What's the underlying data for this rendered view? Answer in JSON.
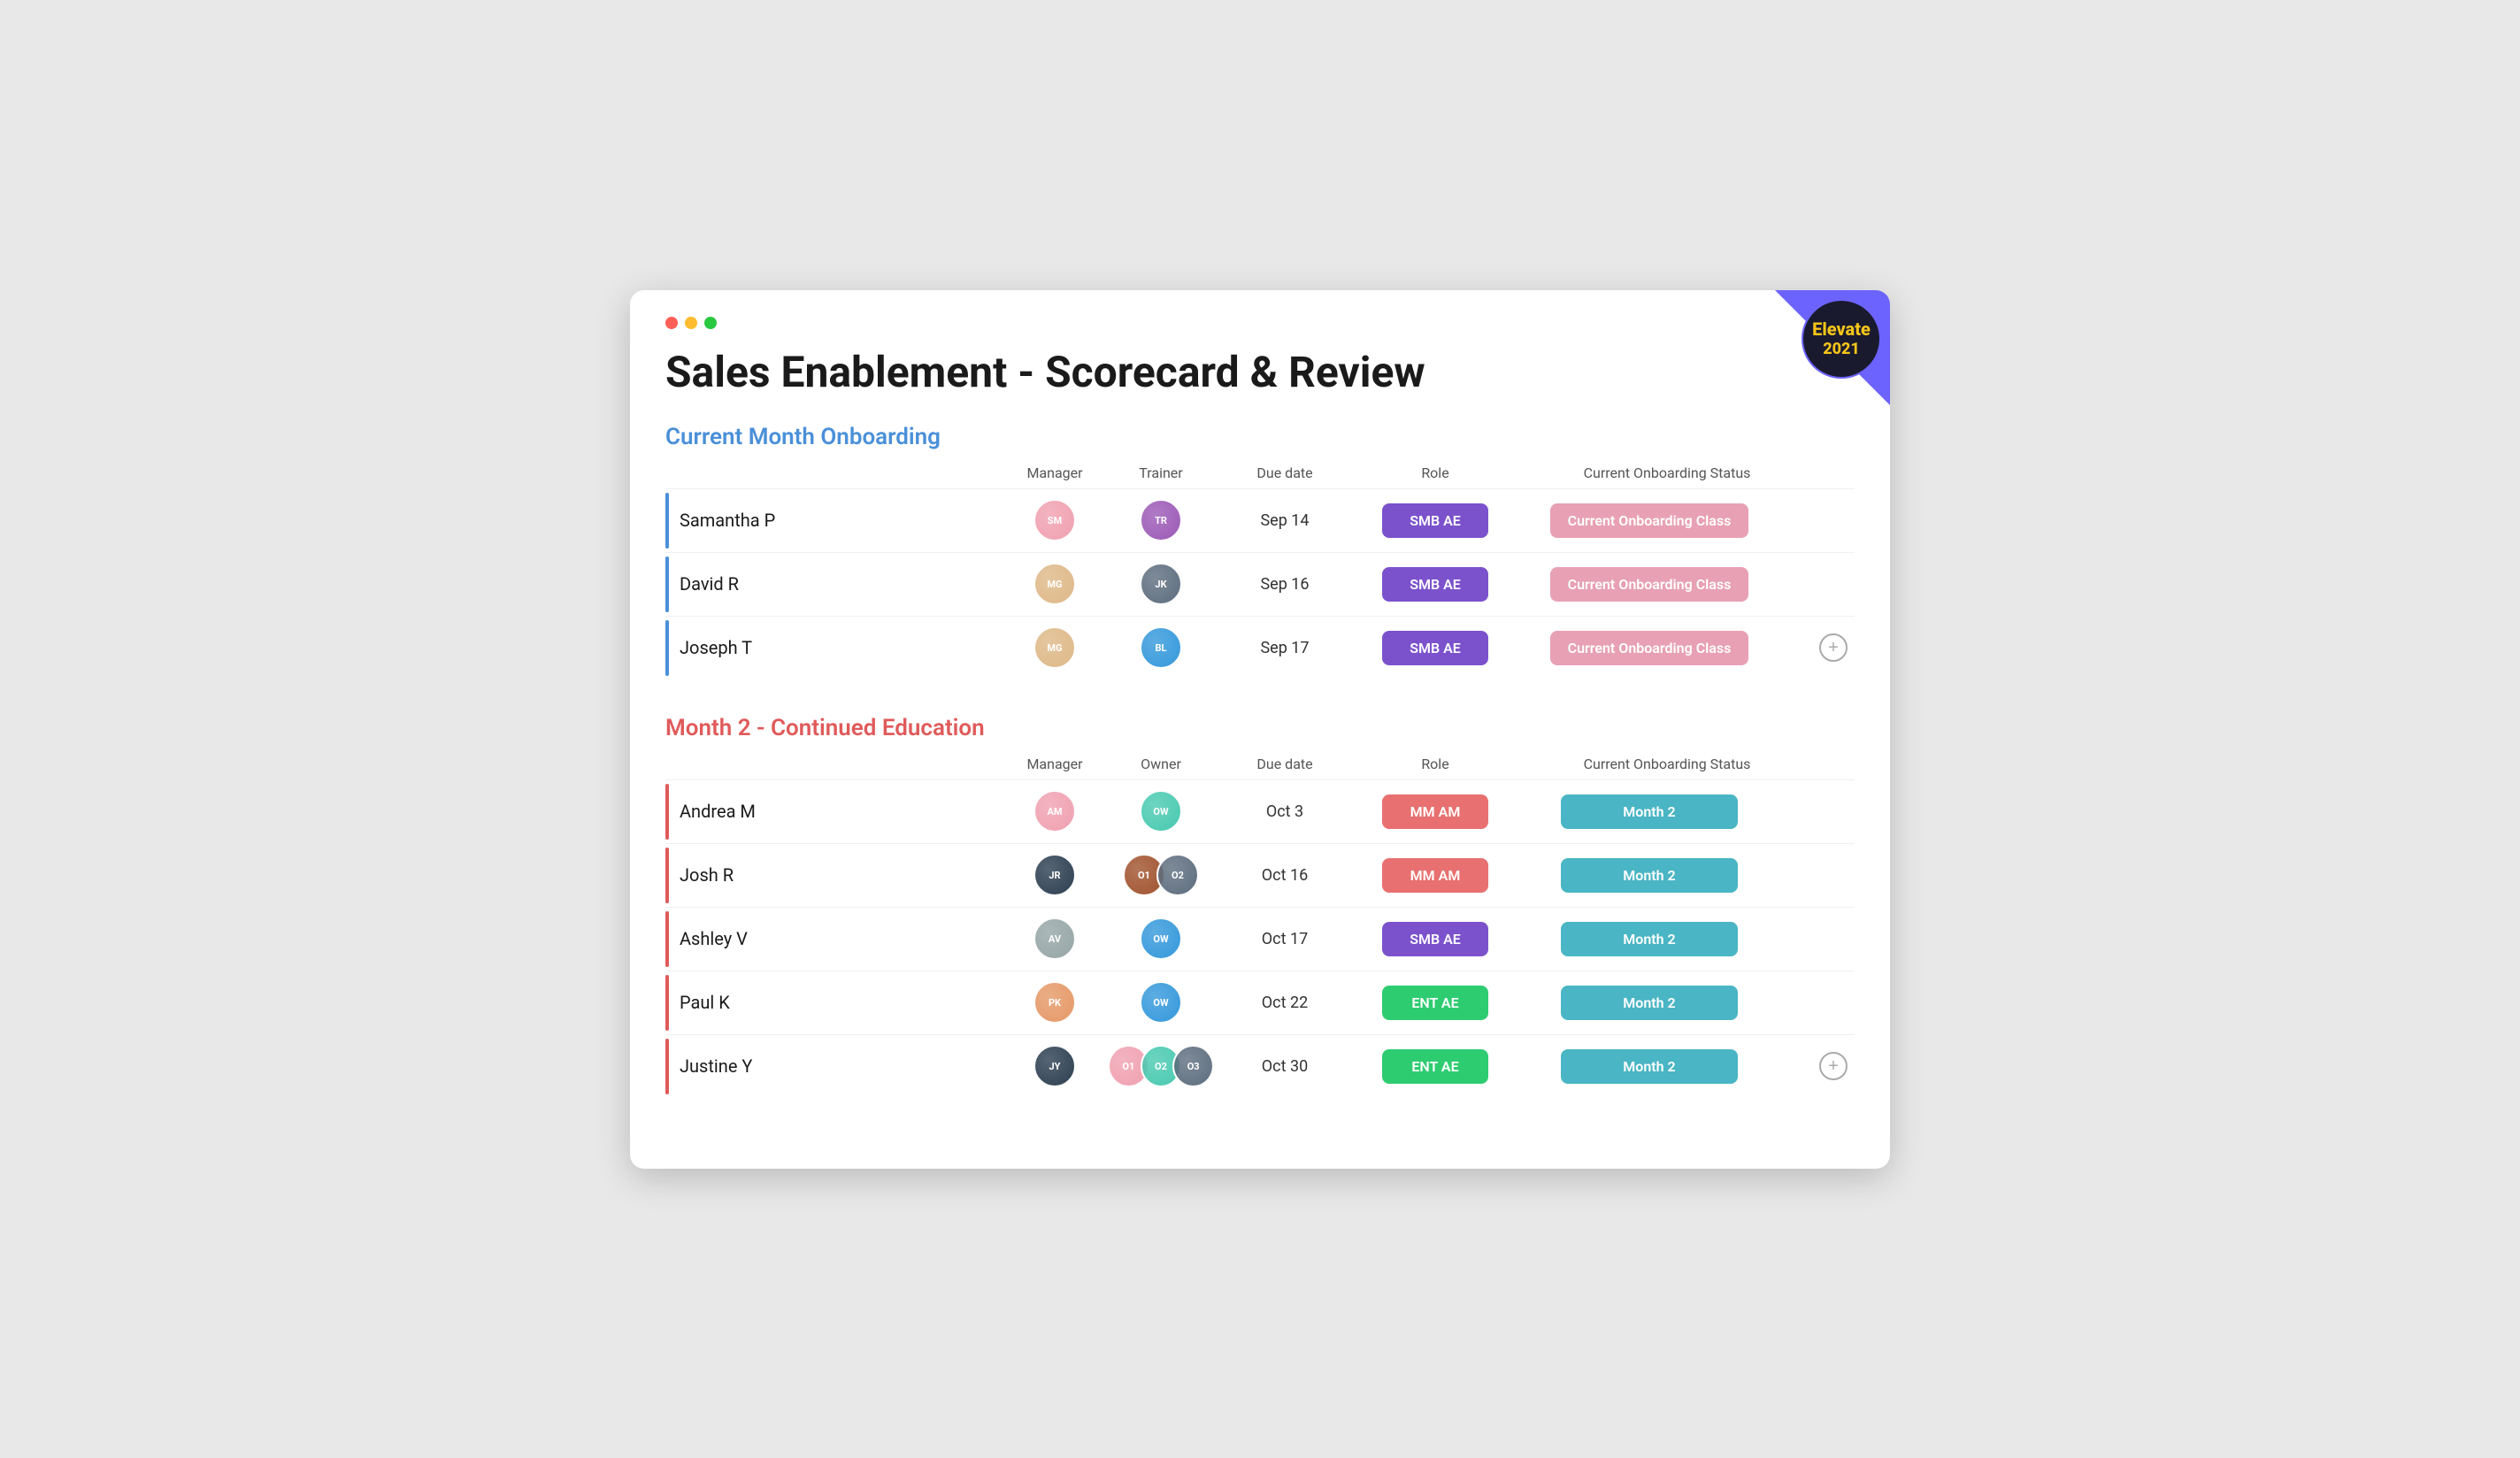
{
  "window": {
    "title": "Sales Enablement - Scorecard & Review"
  },
  "elevate": {
    "line1": "Elevate",
    "line2": "2021"
  },
  "section1": {
    "title": "Current Month Onboarding",
    "columns": {
      "col1": "",
      "manager": "Manager",
      "trainer": "Trainer",
      "dueDate": "Due date",
      "role": "Role",
      "status": "Current Onboarding Status"
    },
    "rows": [
      {
        "name": "Samantha P",
        "dueDate": "Sep 14",
        "role": "SMB AE",
        "roleBadge": "purple",
        "status": "Current Onboarding Class",
        "statusBadge": "pink",
        "managerAvatar": "av-pink",
        "trainerAvatar": "av-purple",
        "managerInitials": "SM",
        "trainerInitials": "TR"
      },
      {
        "name": "David R",
        "dueDate": "Sep 16",
        "role": "SMB AE",
        "roleBadge": "purple",
        "status": "Current Onboarding Class",
        "statusBadge": "pink",
        "managerAvatar": "av-blonde",
        "trainerAvatar": "av-dark",
        "managerInitials": "MG",
        "trainerInitials": "JK"
      },
      {
        "name": "Joseph T",
        "dueDate": "Sep 17",
        "role": "SMB AE",
        "roleBadge": "purple",
        "status": "Current Onboarding Class",
        "statusBadge": "pink",
        "managerAvatar": "av-blonde",
        "trainerAvatar": "av-lightblue",
        "managerInitials": "MG",
        "trainerInitials": "BL"
      }
    ]
  },
  "section2": {
    "title": "Month 2 - Continued Education",
    "columns": {
      "col1": "",
      "manager": "Manager",
      "owner": "Owner",
      "dueDate": "Due date",
      "role": "Role",
      "status": "Current Onboarding Status"
    },
    "rows": [
      {
        "name": "Andrea M",
        "dueDate": "Oct 3",
        "role": "MM AM",
        "roleBadge": "salmon",
        "status": "Month 2",
        "statusBadge": "teal",
        "managerAvatar": "av-pink",
        "ownerAvatars": [
          "av-teal"
        ],
        "ownerCount": 1,
        "managerInitials": "AM",
        "ownerInitials": [
          "OW"
        ]
      },
      {
        "name": "Josh R",
        "dueDate": "Oct 16",
        "role": "MM AM",
        "roleBadge": "salmon",
        "status": "Month 2",
        "statusBadge": "teal",
        "managerAvatar": "av-navy",
        "ownerAvatars": [
          "av-brown",
          "av-dark"
        ],
        "ownerCount": 2,
        "managerInitials": "JR",
        "ownerInitials": [
          "O1",
          "O2"
        ]
      },
      {
        "name": "Ashley V",
        "dueDate": "Oct 17",
        "role": "SMB AE",
        "roleBadge": "purple",
        "status": "Month 2",
        "statusBadge": "teal",
        "managerAvatar": "av-gray",
        "ownerAvatars": [
          "av-lightblue"
        ],
        "ownerCount": 1,
        "managerInitials": "AV",
        "ownerInitials": [
          "OW"
        ]
      },
      {
        "name": "Paul K",
        "dueDate": "Oct 22",
        "role": "ENT AE",
        "roleBadge": "green",
        "status": "Month 2",
        "statusBadge": "teal",
        "managerAvatar": "av-salmon",
        "ownerAvatars": [
          "av-lightblue"
        ],
        "ownerCount": 1,
        "managerInitials": "PK",
        "ownerInitials": [
          "OW"
        ]
      },
      {
        "name": "Justine Y",
        "dueDate": "Oct 30",
        "role": "ENT AE",
        "roleBadge": "green",
        "status": "Month 2",
        "statusBadge": "teal",
        "managerAvatar": "av-navy",
        "ownerAvatars": [
          "av-pink",
          "av-teal",
          "av-dark"
        ],
        "ownerCount": 3,
        "managerInitials": "JY",
        "ownerInitials": [
          "O1",
          "O2",
          "O3"
        ]
      }
    ]
  },
  "addButton": "+"
}
